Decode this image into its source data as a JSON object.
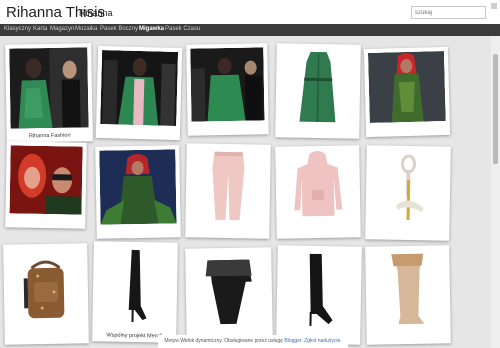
{
  "blog": {
    "title": "Rihanna Thisis",
    "description": "Rihanna"
  },
  "search": {
    "placeholder": "szukaj"
  },
  "nav": {
    "items": [
      {
        "label": "Klasyczny"
      },
      {
        "label": "Karta"
      },
      {
        "label": "Magazyn"
      },
      {
        "label": "Mozaika"
      },
      {
        "label": "Pasek Boczny"
      },
      {
        "label": "Migawka"
      },
      {
        "label": "Pasek Czasu"
      }
    ],
    "active": "Migawka"
  },
  "posts": [
    {
      "caption": "Rihanna Fashion",
      "subject": "rihanna-green-coat"
    },
    {
      "caption": "",
      "subject": "rihanna-green-coat-pink"
    },
    {
      "caption": "",
      "subject": "rihanna-green-coat-crowd"
    },
    {
      "caption": "",
      "subject": "green-leather-trench-coat"
    },
    {
      "caption": "",
      "subject": "poison-ivy-costume"
    },
    {
      "caption": "",
      "subject": "poison-ivy-and-robin"
    },
    {
      "caption": "",
      "subject": "poison-ivy-movie"
    },
    {
      "caption": "",
      "subject": "pink-sweatpants"
    },
    {
      "caption": "",
      "subject": "pink-hoodie"
    },
    {
      "caption": "",
      "subject": "gold-heel-sandal"
    },
    {
      "caption": "",
      "subject": "monogram-backpack"
    },
    {
      "caption": "Wspólny projekt Mendi",
      "subject": "black-thigh-high-boots"
    },
    {
      "caption": "",
      "subject": "fur-boot"
    },
    {
      "caption": "",
      "subject": "black-over-knee-boot"
    },
    {
      "caption": "",
      "subject": "fur-trim-boot"
    }
  ],
  "footer": {
    "text": "Motyw Widok dynamiczny. Obsługiwane przez usługę",
    "link1": "Blogger",
    "link2": "Zgłoś nadużycie"
  },
  "colors": {
    "nav_bg": "#3b3b3b",
    "page_bg": "#e6e6e6",
    "link": "#3a6fb8"
  }
}
